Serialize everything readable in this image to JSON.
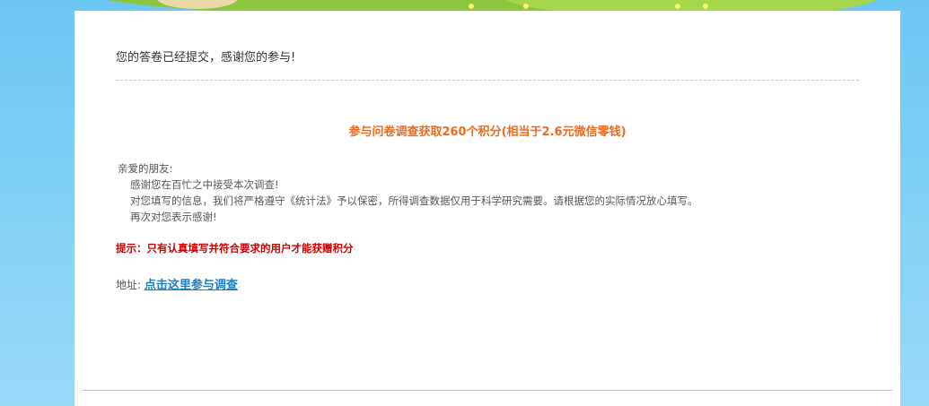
{
  "page": {
    "submitted_message": "您的答卷已经提交，感谢您的参与!",
    "reward_message": "参与问卷调查获取260个积分(相当于2.6元微信零钱)",
    "letter": {
      "greeting": "亲爱的朋友:",
      "line1": "感谢您在百忙之中接受本次调查!",
      "line2": "对您填写的信息，我们将严格遵守《统计法》予以保密，所得调查数据仅用于科学研究需要。请根据您的实际情况放心填写。",
      "line3": "再次对您表示感谢!"
    },
    "tip": "提示：只有认真填写并符合要求的用户才能获赠积分",
    "address_label": "地址:",
    "address_link": "点击这里参与调查"
  },
  "colors": {
    "background": "#7fd0f6",
    "reward": "#ee6a1d",
    "tip": "#d40000",
    "link": "#1a7fc1"
  }
}
